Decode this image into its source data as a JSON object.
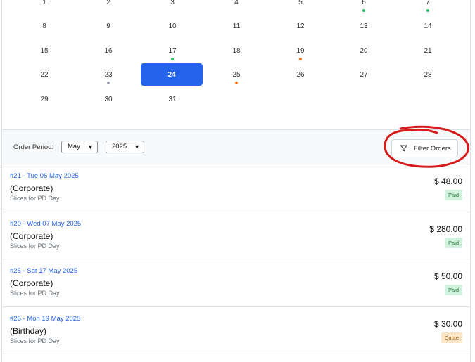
{
  "colors": {
    "accent": "#2563eb",
    "dot_green": "#22c55e",
    "dot_orange": "#f97316",
    "dot_gray": "#9ca3af",
    "annotation": "#d61c1c"
  },
  "calendar": {
    "rows": [
      [
        {
          "day": "1"
        },
        {
          "day": "2"
        },
        {
          "day": "3"
        },
        {
          "day": "4"
        },
        {
          "day": "5"
        },
        {
          "day": "6",
          "dot": "green"
        },
        {
          "day": "7",
          "dot": "green"
        }
      ],
      [
        {
          "day": "8"
        },
        {
          "day": "9"
        },
        {
          "day": "10"
        },
        {
          "day": "11"
        },
        {
          "day": "12"
        },
        {
          "day": "13"
        },
        {
          "day": "14"
        }
      ],
      [
        {
          "day": "15"
        },
        {
          "day": "16"
        },
        {
          "day": "17",
          "dot": "green"
        },
        {
          "day": "18"
        },
        {
          "day": "19",
          "dot": "orange"
        },
        {
          "day": "20"
        },
        {
          "day": "21"
        }
      ],
      [
        {
          "day": "22"
        },
        {
          "day": "23",
          "dot": "gray"
        },
        {
          "day": "24",
          "selected": true
        },
        {
          "day": "25",
          "dot": "orange"
        },
        {
          "day": "26"
        },
        {
          "day": "27"
        },
        {
          "day": "28"
        }
      ],
      [
        {
          "day": "29"
        },
        {
          "day": "30"
        },
        {
          "day": "31"
        }
      ]
    ]
  },
  "filter": {
    "period_label": "Order Period:",
    "month": "May",
    "year": "2025",
    "button_label": "Filter Orders"
  },
  "orders": [
    {
      "ref": "#21 - Tue 06 May 2025",
      "type": "(Corporate)",
      "description": "Slices for PD Day",
      "amount": "$ 48.00",
      "status": "Paid",
      "status_kind": "paid"
    },
    {
      "ref": "#20 - Wed 07 May 2025",
      "type": "(Corporate)",
      "description": "Slices for PD Day",
      "amount": "$ 280.00",
      "status": "Paid",
      "status_kind": "paid"
    },
    {
      "ref": "#25 - Sat 17 May 2025",
      "type": "(Corporate)",
      "description": "Slices for PD Day",
      "amount": "$ 50.00",
      "status": "Paid",
      "status_kind": "paid"
    },
    {
      "ref": "#26 - Mon 19 May 2025",
      "type": "(Birthday)",
      "description": "Slices for PD Day",
      "amount": "$ 30.00",
      "status": "Quote",
      "status_kind": "quote"
    }
  ]
}
